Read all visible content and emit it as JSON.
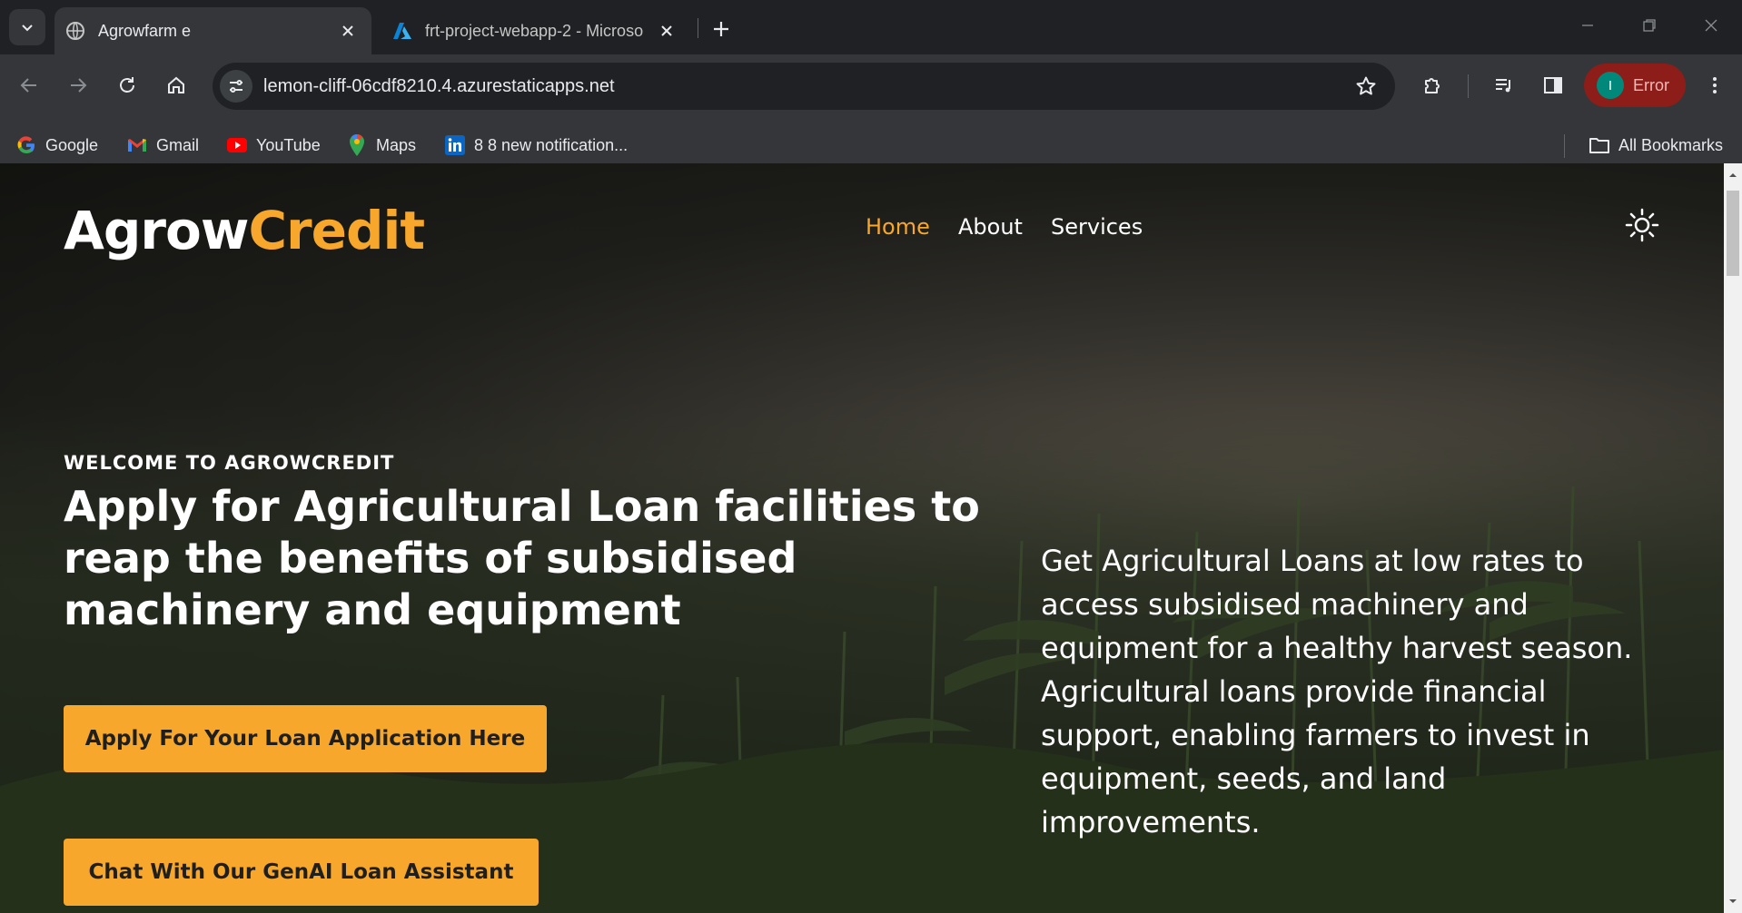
{
  "browser": {
    "tabs": [
      {
        "title": "Agrowfarm e",
        "active": true
      },
      {
        "title": "frt-project-webapp-2 - Microso",
        "active": false
      }
    ],
    "url": "lemon-cliff-06cdf8210.4.azurestaticapps.net",
    "profile": {
      "initial": "I",
      "status": "Error"
    },
    "bookmarks": [
      {
        "label": "Google",
        "icon": "google-icon"
      },
      {
        "label": "Gmail",
        "icon": "gmail-icon"
      },
      {
        "label": "YouTube",
        "icon": "youtube-icon"
      },
      {
        "label": "Maps",
        "icon": "maps-icon"
      },
      {
        "label": "8 8 new notification...",
        "icon": "linkedin-icon"
      }
    ],
    "all_bookmarks": "All Bookmarks"
  },
  "site": {
    "logo": {
      "part1": "Agrow",
      "part2": "Credit"
    },
    "nav": [
      "Home",
      "About",
      "Services"
    ],
    "active_nav": "Home"
  },
  "hero": {
    "eyebrow": "WELCOME TO AGROWCREDIT",
    "headline": "Apply for Agricultural Loan facilities to reap the benefits of subsidised machinery and equipment",
    "description": "Get Agricultural Loans at low rates to access subsidised machinery and equipment for a healthy harvest season. Agricultural loans provide financial support, enabling farmers to invest in equipment, seeds, and land improvements.",
    "cta_primary": "Apply For Your Loan Application Here",
    "cta_secondary": "Chat With Our GenAI Loan Assistant"
  },
  "colors": {
    "accent": "#f7a72b",
    "chrome_dark": "#202124",
    "chrome_toolbar": "#35363a",
    "profile_error": "#8c1d18"
  }
}
